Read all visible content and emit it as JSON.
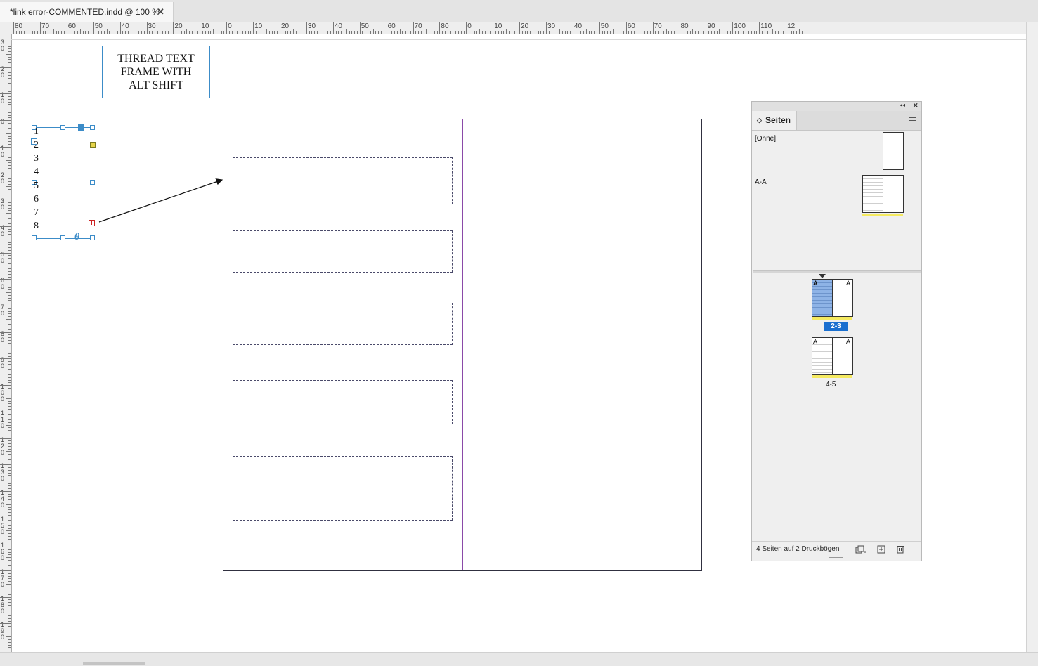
{
  "document_tab": {
    "title": "*link error-COMMENTED.indd @ 100 %",
    "close_glyph": "✕"
  },
  "rulers": {
    "horizontal_ticks": [
      "80",
      "70",
      "60",
      "50",
      "40",
      "30",
      "20",
      "10",
      "0",
      "10",
      "20",
      "30",
      "40",
      "50",
      "60",
      "70",
      "80",
      "0",
      "10",
      "20",
      "30",
      "40",
      "50",
      "60",
      "70",
      "80",
      "90",
      "100",
      "110",
      "12"
    ],
    "vertical_ticks": [
      "3 0",
      "2 0",
      "1 0",
      "0",
      "1 0",
      "2 0",
      "3 0",
      "4 0",
      "5 0",
      "6 0",
      "7 0",
      "8 0",
      "9 0",
      "1 0 0",
      "1 1 0",
      "1 2 0",
      "1 3 0",
      "1 4 0",
      "1 5 0",
      "1 6 0",
      "1 7 0",
      "1 8 0",
      "1 9 0"
    ]
  },
  "annotation": {
    "lines": [
      "THREAD TEXT",
      "FRAME WITH",
      "ALT SHIFT"
    ]
  },
  "text_frame": {
    "lines": [
      "1",
      "2",
      "3",
      "4",
      "5",
      "6",
      "7",
      "8"
    ],
    "overset_glyph": "θ"
  },
  "pages_panel": {
    "tab_label": "Seiten",
    "collapse_glyph": "◂◂",
    "close_glyph": "✕",
    "masters": [
      {
        "label": "[Ohne]"
      },
      {
        "label": "A-A"
      }
    ],
    "spreads": [
      {
        "label": "2-3",
        "left_master": "A",
        "right_master": "A",
        "selected": true
      },
      {
        "label": "4-5",
        "left_master": "A",
        "right_master": "A",
        "selected": false
      }
    ],
    "footer_status": "4 Seiten auf 2 Druckbögen",
    "footer_icons": [
      "page-size-icon",
      "new-page-icon",
      "delete-page-icon"
    ],
    "highlight_color": "#1a6fcf"
  }
}
